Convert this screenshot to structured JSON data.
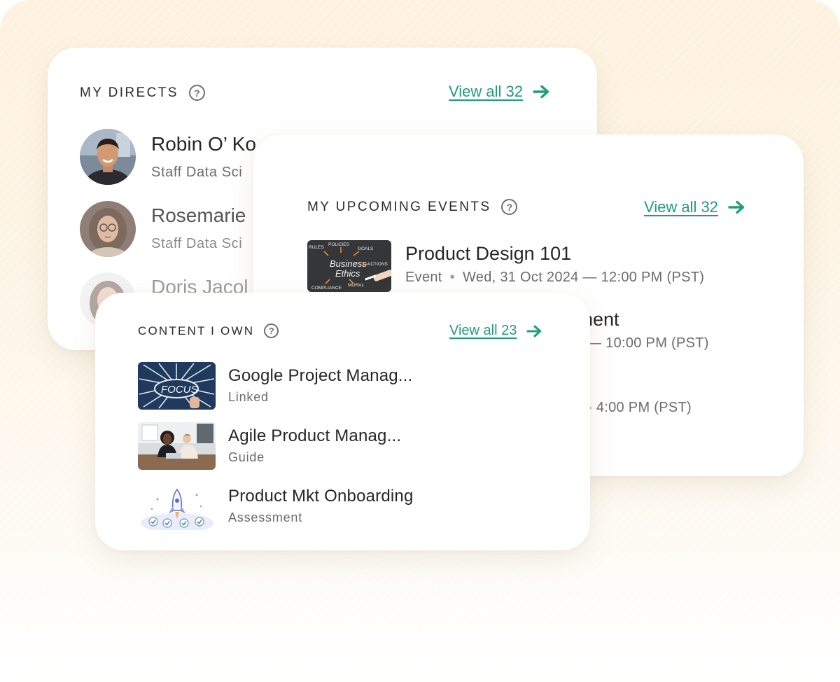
{
  "directs": {
    "title": "MY DIRECTS",
    "view_all": "View all 32",
    "people": [
      {
        "name": "Robin O’ Ko",
        "role": "Staff Data Sci"
      },
      {
        "name": "Rosemarie",
        "role": "Staff Data Sci"
      },
      {
        "name": "Doris Jacol",
        "role": ""
      }
    ]
  },
  "events": {
    "title": "MY UPCOMING EVENTS",
    "view_all": "View all 32",
    "items": [
      {
        "title": "Product Design 101",
        "type": "Event",
        "separator": "•",
        "datetime": "Wed, 31 Oct 2024 — 12:00 PM (PST)",
        "thumb_words": [
          "Business",
          "Ethics",
          "RULES",
          "POLICIES",
          "GOALS",
          "ACTIONS",
          "COMPLIANCE",
          "MORAL"
        ]
      },
      {
        "title_fragment": "nent",
        "datetime_fragment": "— 10:00 PM (PST)"
      },
      {
        "datetime_fragment": "- 4:00 PM (PST)"
      }
    ]
  },
  "content": {
    "title": "CONTENT I OWN",
    "view_all": "View all 23",
    "items": [
      {
        "title": "Google Project Manag...",
        "type": "Linked",
        "thumb_word": "FOCUS"
      },
      {
        "title": "Agile Product Manag...",
        "type": "Guide"
      },
      {
        "title": "Product Mkt Onboarding",
        "type": "Assessment"
      }
    ]
  },
  "icons": {
    "help": "?",
    "view_all_arrow": "arrow-right-icon"
  },
  "colors": {
    "accent": "#1f9e78",
    "text_primary": "#262626",
    "text_secondary": "#6b6b6b",
    "background_top": "#fdf2dd"
  }
}
